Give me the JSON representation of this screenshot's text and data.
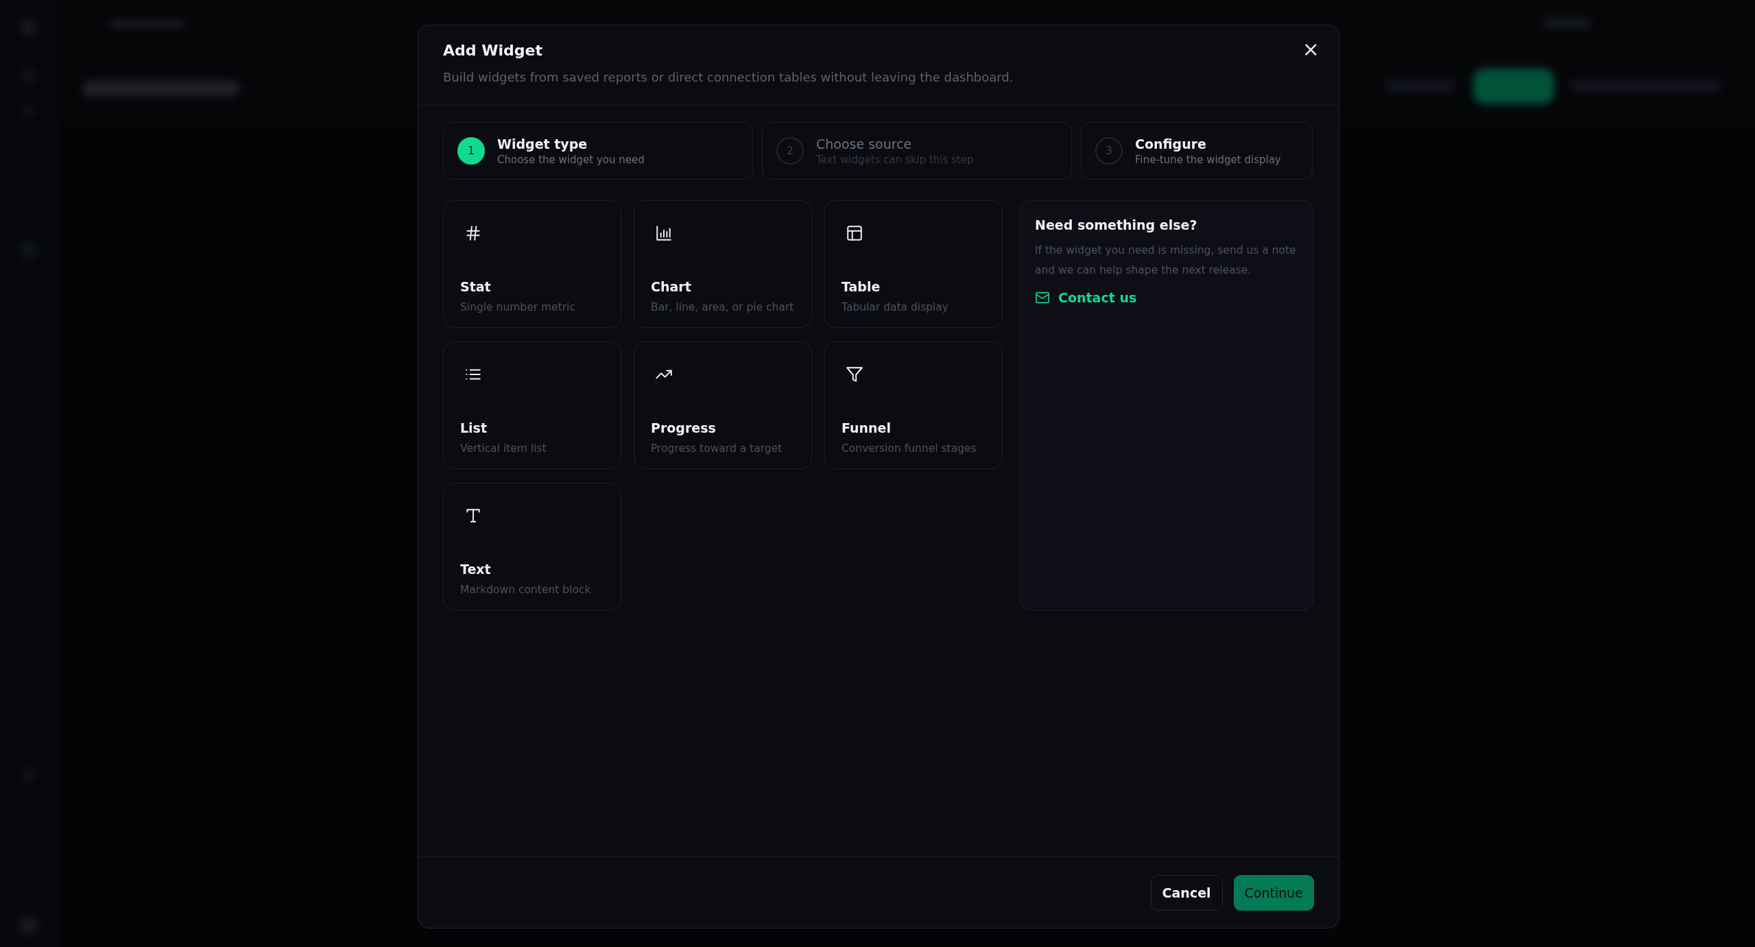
{
  "dialog": {
    "title": "Add Widget",
    "subtitle": "Build widgets from saved reports or direct connection tables without leaving the dashboard.",
    "close": "×"
  },
  "steps": [
    {
      "number": "1",
      "title": "Widget type",
      "caption": "Choose the widget you need",
      "selected": true,
      "disabled": false
    },
    {
      "number": "2",
      "title": "Choose source",
      "caption": "Text widgets can skip this step",
      "selected": false,
      "disabled": true
    },
    {
      "number": "3",
      "title": "Configure",
      "caption": "Fine-tune the widget display",
      "selected": false,
      "disabled": false
    }
  ],
  "widget_types": [
    {
      "kind": "stat",
      "title": "Stat",
      "description": "Single number metric",
      "selected": false
    },
    {
      "kind": "chart",
      "title": "Chart",
      "description": "Bar, line, area, or pie chart",
      "selected": false
    },
    {
      "kind": "table",
      "title": "Table",
      "description": "Tabular data display",
      "selected": false
    },
    {
      "kind": "list",
      "title": "List",
      "description": "Vertical item list",
      "selected": false
    },
    {
      "kind": "progress",
      "title": "Progress",
      "description": "Progress toward a target",
      "selected": false
    },
    {
      "kind": "funnel",
      "title": "Funnel",
      "description": "Conversion funnel stages",
      "selected": false
    },
    {
      "kind": "text",
      "title": "Text",
      "description": "Markdown content block",
      "selected": false
    }
  ],
  "help_panel": {
    "title": "Need something else?",
    "body": "If the widget you need is missing, send us a note and we can help shape the next release.",
    "link": "Contact us"
  },
  "buttons": [
    {
      "kind": "secondary",
      "label": "Cancel"
    },
    {
      "kind": "primary",
      "label": "Continue"
    }
  ]
}
